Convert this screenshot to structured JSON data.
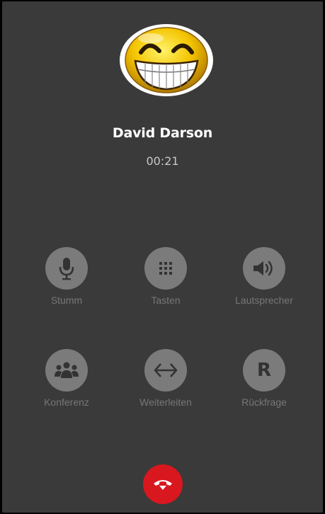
{
  "caller": {
    "name": "David Darson",
    "duration": "00:21"
  },
  "actions": {
    "mute": {
      "label": "Stumm",
      "icon": "microphone-icon"
    },
    "keypad": {
      "label": "Tasten",
      "icon": "keypad-icon"
    },
    "speaker": {
      "label": "Lautsprecher",
      "icon": "speaker-icon"
    },
    "conference": {
      "label": "Konferenz",
      "icon": "group-icon"
    },
    "transfer": {
      "label": "Weiterleiten",
      "icon": "transfer-arrows-icon"
    },
    "consult": {
      "label": "Rückfrage",
      "icon": "r-letter-icon",
      "glyph": "R"
    }
  },
  "hangup": {
    "icon": "hang-up-phone-icon"
  },
  "colors": {
    "background": "#3a3a3a",
    "button": "#7b7b7b",
    "label": "#777777",
    "hangup": "#d8171f",
    "name": "#ffffff"
  }
}
